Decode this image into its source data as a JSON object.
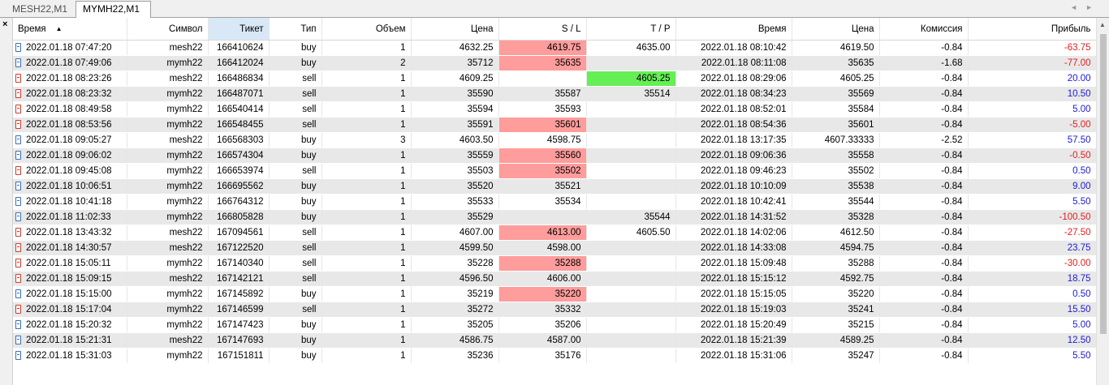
{
  "tabs": [
    {
      "label": "MESH22,M1",
      "active": false
    },
    {
      "label": "MYMH22,M1",
      "active": true
    }
  ],
  "nav_icons": [
    "chevron-left-icon",
    "chevron-right-icon"
  ],
  "close_label": "×",
  "sort_indicator": "▲",
  "columns": [
    "Время",
    "Символ",
    "Тикет",
    "Тип",
    "Объем",
    "Цена",
    "S / L",
    "T / P",
    "Время",
    "Цена",
    "Комиссия",
    "Прибыль"
  ],
  "colors": {
    "sl_hit": "#ff9c9c",
    "tp_hit": "#66ee55",
    "profit_positive": "#1b1bd6",
    "profit_negative": "#e02020",
    "alt_row": "#e8e8e8",
    "sorted_header": "#d8e8f7"
  },
  "rows": [
    {
      "time_open": "2022.01.18 07:47:20",
      "symbol": "mesh22",
      "ticket": "166410624",
      "type": "buy",
      "volume": "1",
      "price_open": "4632.25",
      "sl": "4619.75",
      "sl_hit": true,
      "tp": "4635.00",
      "tp_hit": false,
      "time_close": "2022.01.18 08:10:42",
      "price_close": "4619.50",
      "commission": "-0.84",
      "profit": "-63.75"
    },
    {
      "time_open": "2022.01.18 07:49:06",
      "symbol": "mymh22",
      "ticket": "166412024",
      "type": "buy",
      "volume": "2",
      "price_open": "35712",
      "sl": "35635",
      "sl_hit": true,
      "tp": "",
      "tp_hit": false,
      "time_close": "2022.01.18 08:11:08",
      "price_close": "35635",
      "commission": "-1.68",
      "profit": "-77.00"
    },
    {
      "time_open": "2022.01.18 08:23:26",
      "symbol": "mesh22",
      "ticket": "166486834",
      "type": "sell",
      "volume": "1",
      "price_open": "4609.25",
      "sl": "",
      "sl_hit": false,
      "tp": "4605.25",
      "tp_hit": true,
      "time_close": "2022.01.18 08:29:06",
      "price_close": "4605.25",
      "commission": "-0.84",
      "profit": "20.00"
    },
    {
      "time_open": "2022.01.18 08:23:32",
      "symbol": "mymh22",
      "ticket": "166487071",
      "type": "sell",
      "volume": "1",
      "price_open": "35590",
      "sl": "35587",
      "sl_hit": false,
      "tp": "35514",
      "tp_hit": false,
      "time_close": "2022.01.18 08:34:23",
      "price_close": "35569",
      "commission": "-0.84",
      "profit": "10.50"
    },
    {
      "time_open": "2022.01.18 08:49:58",
      "symbol": "mymh22",
      "ticket": "166540414",
      "type": "sell",
      "volume": "1",
      "price_open": "35594",
      "sl": "35593",
      "sl_hit": false,
      "tp": "",
      "tp_hit": false,
      "time_close": "2022.01.18 08:52:01",
      "price_close": "35584",
      "commission": "-0.84",
      "profit": "5.00"
    },
    {
      "time_open": "2022.01.18 08:53:56",
      "symbol": "mymh22",
      "ticket": "166548455",
      "type": "sell",
      "volume": "1",
      "price_open": "35591",
      "sl": "35601",
      "sl_hit": true,
      "tp": "",
      "tp_hit": false,
      "time_close": "2022.01.18 08:54:36",
      "price_close": "35601",
      "commission": "-0.84",
      "profit": "-5.00"
    },
    {
      "time_open": "2022.01.18 09:05:27",
      "symbol": "mesh22",
      "ticket": "166568303",
      "type": "buy",
      "volume": "3",
      "price_open": "4603.50",
      "sl": "4598.75",
      "sl_hit": false,
      "tp": "",
      "tp_hit": false,
      "time_close": "2022.01.18 13:17:35",
      "price_close": "4607.33333",
      "commission": "-2.52",
      "profit": "57.50"
    },
    {
      "time_open": "2022.01.18 09:06:02",
      "symbol": "mymh22",
      "ticket": "166574304",
      "type": "buy",
      "volume": "1",
      "price_open": "35559",
      "sl": "35560",
      "sl_hit": true,
      "tp": "",
      "tp_hit": false,
      "time_close": "2022.01.18 09:06:36",
      "price_close": "35558",
      "commission": "-0.84",
      "profit": "-0.50"
    },
    {
      "time_open": "2022.01.18 09:45:08",
      "symbol": "mymh22",
      "ticket": "166653974",
      "type": "sell",
      "volume": "1",
      "price_open": "35503",
      "sl": "35502",
      "sl_hit": true,
      "tp": "",
      "tp_hit": false,
      "time_close": "2022.01.18 09:46:23",
      "price_close": "35502",
      "commission": "-0.84",
      "profit": "0.50"
    },
    {
      "time_open": "2022.01.18 10:06:51",
      "symbol": "mymh22",
      "ticket": "166695562",
      "type": "buy",
      "volume": "1",
      "price_open": "35520",
      "sl": "35521",
      "sl_hit": false,
      "tp": "",
      "tp_hit": false,
      "time_close": "2022.01.18 10:10:09",
      "price_close": "35538",
      "commission": "-0.84",
      "profit": "9.00"
    },
    {
      "time_open": "2022.01.18 10:41:18",
      "symbol": "mymh22",
      "ticket": "166764312",
      "type": "buy",
      "volume": "1",
      "price_open": "35533",
      "sl": "35534",
      "sl_hit": false,
      "tp": "",
      "tp_hit": false,
      "time_close": "2022.01.18 10:42:41",
      "price_close": "35544",
      "commission": "-0.84",
      "profit": "5.50"
    },
    {
      "time_open": "2022.01.18 11:02:33",
      "symbol": "mymh22",
      "ticket": "166805828",
      "type": "buy",
      "volume": "1",
      "price_open": "35529",
      "sl": "",
      "sl_hit": false,
      "tp": "35544",
      "tp_hit": false,
      "time_close": "2022.01.18 14:31:52",
      "price_close": "35328",
      "commission": "-0.84",
      "profit": "-100.50"
    },
    {
      "time_open": "2022.01.18 13:43:32",
      "symbol": "mesh22",
      "ticket": "167094561",
      "type": "sell",
      "volume": "1",
      "price_open": "4607.00",
      "sl": "4613.00",
      "sl_hit": true,
      "tp": "4605.50",
      "tp_hit": false,
      "time_close": "2022.01.18 14:02:06",
      "price_close": "4612.50",
      "commission": "-0.84",
      "profit": "-27.50"
    },
    {
      "time_open": "2022.01.18 14:30:57",
      "symbol": "mesh22",
      "ticket": "167122520",
      "type": "sell",
      "volume": "1",
      "price_open": "4599.50",
      "sl": "4598.00",
      "sl_hit": false,
      "tp": "",
      "tp_hit": false,
      "time_close": "2022.01.18 14:33:08",
      "price_close": "4594.75",
      "commission": "-0.84",
      "profit": "23.75"
    },
    {
      "time_open": "2022.01.18 15:05:11",
      "symbol": "mymh22",
      "ticket": "167140340",
      "type": "sell",
      "volume": "1",
      "price_open": "35228",
      "sl": "35288",
      "sl_hit": true,
      "tp": "",
      "tp_hit": false,
      "time_close": "2022.01.18 15:09:48",
      "price_close": "35288",
      "commission": "-0.84",
      "profit": "-30.00"
    },
    {
      "time_open": "2022.01.18 15:09:15",
      "symbol": "mesh22",
      "ticket": "167142121",
      "type": "sell",
      "volume": "1",
      "price_open": "4596.50",
      "sl": "4606.00",
      "sl_hit": false,
      "tp": "",
      "tp_hit": false,
      "time_close": "2022.01.18 15:15:12",
      "price_close": "4592.75",
      "commission": "-0.84",
      "profit": "18.75"
    },
    {
      "time_open": "2022.01.18 15:15:00",
      "symbol": "mymh22",
      "ticket": "167145892",
      "type": "buy",
      "volume": "1",
      "price_open": "35219",
      "sl": "35220",
      "sl_hit": true,
      "tp": "",
      "tp_hit": false,
      "time_close": "2022.01.18 15:15:05",
      "price_close": "35220",
      "commission": "-0.84",
      "profit": "0.50"
    },
    {
      "time_open": "2022.01.18 15:17:04",
      "symbol": "mymh22",
      "ticket": "167146599",
      "type": "sell",
      "volume": "1",
      "price_open": "35272",
      "sl": "35332",
      "sl_hit": false,
      "tp": "",
      "tp_hit": false,
      "time_close": "2022.01.18 15:19:03",
      "price_close": "35241",
      "commission": "-0.84",
      "profit": "15.50"
    },
    {
      "time_open": "2022.01.18 15:20:32",
      "symbol": "mymh22",
      "ticket": "167147423",
      "type": "buy",
      "volume": "1",
      "price_open": "35205",
      "sl": "35206",
      "sl_hit": false,
      "tp": "",
      "tp_hit": false,
      "time_close": "2022.01.18 15:20:49",
      "price_close": "35215",
      "commission": "-0.84",
      "profit": "5.00"
    },
    {
      "time_open": "2022.01.18 15:21:31",
      "symbol": "mesh22",
      "ticket": "167147693",
      "type": "buy",
      "volume": "1",
      "price_open": "4586.75",
      "sl": "4587.00",
      "sl_hit": false,
      "tp": "",
      "tp_hit": false,
      "time_close": "2022.01.18 15:21:39",
      "price_close": "4589.25",
      "commission": "-0.84",
      "profit": "12.50"
    },
    {
      "time_open": "2022.01.18 15:31:03",
      "symbol": "mymh22",
      "ticket": "167151811",
      "type": "buy",
      "volume": "1",
      "price_open": "35236",
      "sl": "35176",
      "sl_hit": false,
      "tp": "",
      "tp_hit": false,
      "time_close": "2022.01.18 15:31:06",
      "price_close": "35247",
      "commission": "-0.84",
      "profit": "5.50"
    }
  ]
}
